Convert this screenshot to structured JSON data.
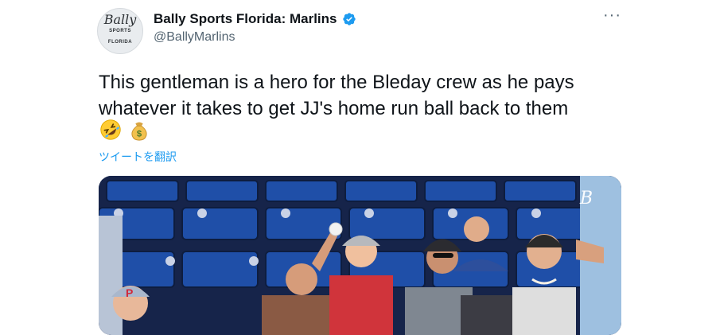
{
  "author": {
    "display_name": "Bally Sports Florida: Marlins",
    "handle": "@BallyMarlins",
    "avatar_logo_text": "Bally",
    "avatar_logo_subtext": "SPORTS FLORIDA",
    "verified": true
  },
  "tweet": {
    "text": "This gentleman is a hero for the Bleday crew as he pays whatever it takes to get JJ's home run ball back to them",
    "emojis": [
      "rolling-on-floor-laughing",
      "money-bag"
    ],
    "translate_label": "ツイートを翻訳"
  },
  "menu": {
    "more_label": "···"
  },
  "media": {
    "watermark_text": "B",
    "description_icons": [
      "stadium-seats",
      "fans"
    ]
  },
  "colors": {
    "link": "#1d9bf0",
    "secondary_text": "#536471",
    "verified": "#1d9bf0",
    "seat_blue": "#1f4fa8"
  }
}
